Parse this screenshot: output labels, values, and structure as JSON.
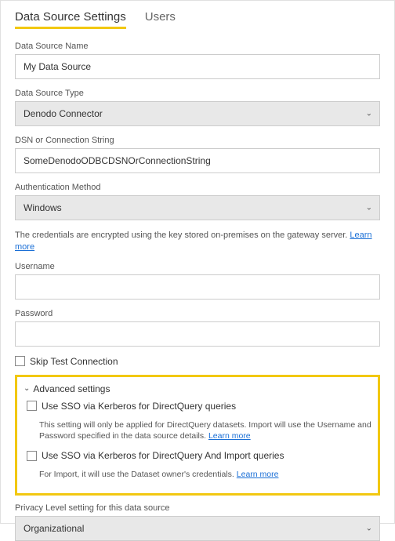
{
  "tabs": {
    "settings": "Data Source Settings",
    "users": "Users"
  },
  "labels": {
    "dataSourceName": "Data Source Name",
    "dataSourceType": "Data Source Type",
    "dsn": "DSN or Connection String",
    "authMethod": "Authentication Method",
    "username": "Username",
    "password": "Password",
    "skipTest": "Skip Test Connection",
    "advanced": "Advanced settings",
    "ssoDirectQuery": "Use SSO via Kerberos for DirectQuery queries",
    "ssoImport": "Use SSO via Kerberos for DirectQuery And Import queries",
    "privacy": "Privacy Level setting for this data source"
  },
  "values": {
    "dataSourceName": "My Data Source",
    "dataSourceType": "Denodo Connector",
    "dsn": "SomeDenodoODBCDSNOrConnectionString",
    "authMethod": "Windows",
    "username": "",
    "password": "",
    "privacy": "Organizational"
  },
  "helper": {
    "credentials": "The credentials are encrypted using the key stored on-premises on the gateway server. ",
    "learnMore": "Learn more",
    "ssoDirectQueryDesc": "This setting will only be applied for DirectQuery datasets. Import will use the Username and Password specified in the data source details. ",
    "ssoImportDesc": "For Import, it will use the Dataset owner's credentials. "
  }
}
